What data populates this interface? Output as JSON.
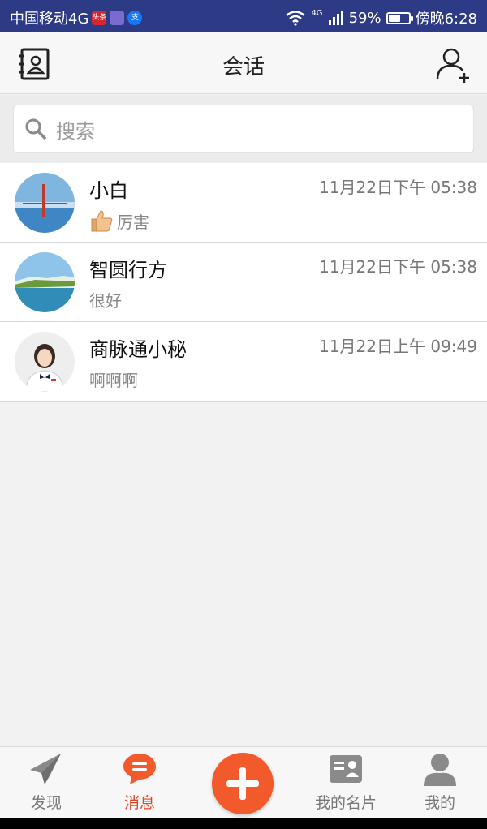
{
  "status_bar": {
    "carrier": "中国移动4G",
    "app_icons": [
      "头条",
      "",
      "支"
    ],
    "network": "4G",
    "battery_percent": "59%",
    "battery_level": 0.59,
    "time": "傍晚6:28"
  },
  "header": {
    "title": "会话"
  },
  "search": {
    "placeholder": "搜索"
  },
  "conversations": [
    {
      "name": "小白",
      "time": "11月22日下午 05:38",
      "preview": "厉害",
      "has_thumb_emoji": true
    },
    {
      "name": "智圆行方",
      "time": "11月22日下午 05:38",
      "preview": "很好",
      "has_thumb_emoji": false
    },
    {
      "name": "商脉通小秘",
      "time": "11月22日上午 09:49",
      "preview": "啊啊啊",
      "has_thumb_emoji": false
    }
  ],
  "bottom_nav": {
    "items": [
      {
        "label": "发现",
        "icon": "paper-plane-icon"
      },
      {
        "label": "消息",
        "icon": "chat-bubble-icon"
      },
      {
        "label": "我的名片",
        "icon": "business-card-icon"
      },
      {
        "label": "我的",
        "icon": "person-icon"
      }
    ],
    "active_index": 1
  },
  "colors": {
    "status_bar": "#2d3a85",
    "accent": "#f25a2b",
    "active_label": "#e5472a"
  }
}
